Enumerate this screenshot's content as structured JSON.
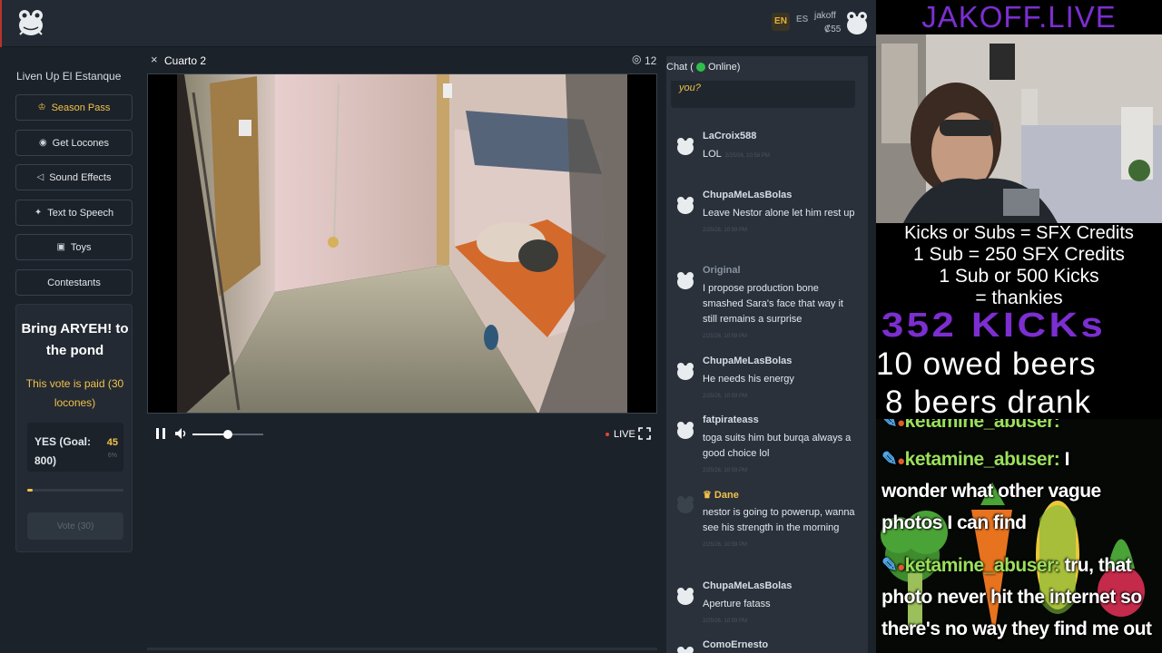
{
  "header": {
    "lang_en": "EN",
    "lang_es": "ES",
    "user_name": "jakoff",
    "user_balance": "₡55"
  },
  "sidebar": {
    "title": "Liven Up El Estanque",
    "items": [
      {
        "label": "Season Pass",
        "icon": "crown-icon"
      },
      {
        "label": "Get Locones",
        "icon": "coin-icon"
      },
      {
        "label": "Sound Effects",
        "icon": "speaker-icon"
      },
      {
        "label": "Text to Speech",
        "icon": "sparkle-icon"
      },
      {
        "label": "Toys",
        "icon": "gift-icon"
      },
      {
        "label": "Contestants",
        "icon": ""
      }
    ],
    "vote": {
      "title": "Bring ARYEH! to the pond",
      "note": "This vote is paid (30 locones)",
      "option_label": "YES (Goal: 800)",
      "count": "45",
      "percent": "6%",
      "progress_fraction": 0.06,
      "button_label": "Vote (30)"
    }
  },
  "video": {
    "close": "×",
    "title": "Cuarto 2",
    "viewers": "12",
    "live_label": "LIVE",
    "volume_fraction": 0.5
  },
  "chat": {
    "header_prefix": "Chat (",
    "header_status": "Online)",
    "prev_snippet": "you?",
    "messages": [
      {
        "user": "LaCroix588",
        "text": "LOL",
        "time": "2/25/26, 10:58 PM",
        "user_style": "normal"
      },
      {
        "user": "ChupaMeLasBolas",
        "text": "Leave Nestor alone let him rest up",
        "time": "2/25/26, 10:59 PM",
        "user_style": "normal"
      },
      {
        "user": "Original",
        "text": "I propose production bone smashed Sara's face that way it still remains a surprise",
        "time": "2/25/26, 10:59 PM",
        "user_style": "gray"
      },
      {
        "user": "ChupaMeLasBolas",
        "text": "He needs his energy",
        "time": "2/25/26, 10:59 PM",
        "user_style": "normal"
      },
      {
        "user": "fatpirateass",
        "text": "toga suits him but burqa always a good choice lol",
        "time": "2/25/26, 10:59 PM",
        "user_style": "normal"
      },
      {
        "user": "Dane",
        "text": "nestor is going to powerup, wanna see his strength in the morning",
        "time": "2/25/26, 10:59 PM",
        "user_style": "gold"
      },
      {
        "user": "ChupaMeLasBolas",
        "text": "Aperture fatass",
        "time": "2/25/26, 10:59 PM",
        "user_style": "normal"
      },
      {
        "user": "ComoErnesto",
        "text": "",
        "time": "",
        "user_style": "normal"
      }
    ]
  },
  "overlay": {
    "site_title": "JAKOFF.LIVE",
    "line1": "Kicks or Subs = SFX Credits",
    "line2": "1 Sub = 250 SFX Credits",
    "line3": "1 Sub or 500 Kicks",
    "line4": "= thankies",
    "kicks": "352 KICKs",
    "beers_owed": "10 owed beers",
    "beers_drank": "8 beers drank",
    "chat_lines": [
      {
        "user": "ketamine_abuser:",
        "text": ""
      },
      {
        "user": "ketamine_abuser:",
        "text": " I"
      },
      {
        "user": "",
        "text": "wonder what other vague"
      },
      {
        "user": "",
        "text": "photos I can find"
      },
      {
        "user": "ketamine_abuser:",
        "text": " tru, that"
      },
      {
        "user": "",
        "text": "photo never hit the internet so"
      },
      {
        "user": "",
        "text": "there's no way they find me out"
      }
    ]
  },
  "colors": {
    "accent": "#f2c14a",
    "online": "#2fbf4b",
    "live": "#e0453a",
    "overlay_purple": "#7c2ed1",
    "overlay_chat_user": "#9be05a"
  }
}
